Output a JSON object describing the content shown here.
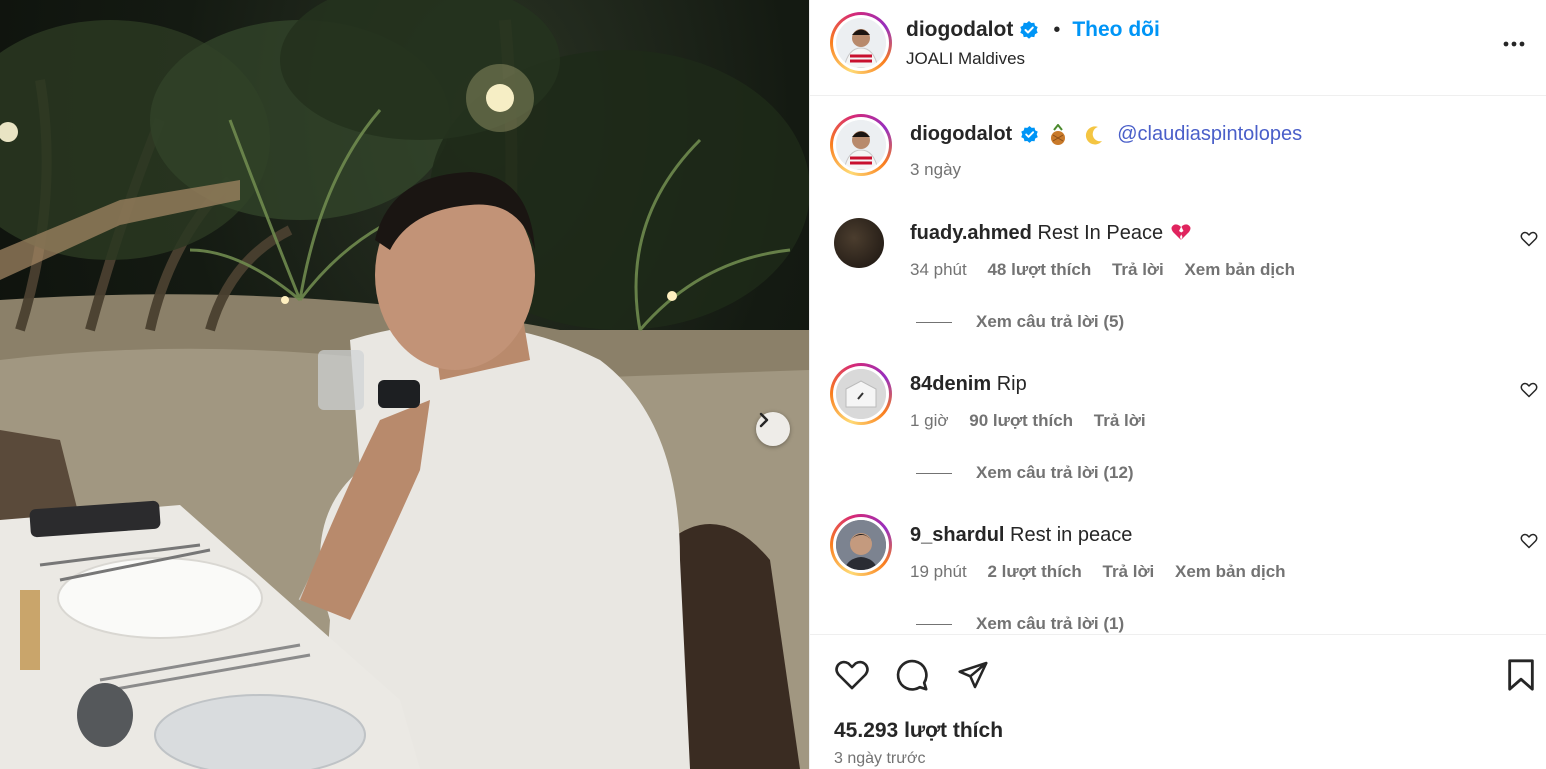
{
  "post": {
    "author": "diogodalot",
    "follow_label": "Theo dõi",
    "location": "JOALI Maldives",
    "caption_mention": "@claudiaspintolopes",
    "caption_time": "3 ngày",
    "likes": "45.293 lượt thích",
    "posted": "3 ngày trước"
  },
  "comments": [
    {
      "user": "fuady.ahmed",
      "text": "Rest In Peace",
      "time": "34 phút",
      "likes": "48 lượt thích",
      "reply": "Trả lời",
      "translate": "Xem bản dịch",
      "view_replies": "Xem câu trả lời (5)"
    },
    {
      "user": "84denim",
      "text": "Rip",
      "time": "1 giờ",
      "likes": "90 lượt thích",
      "reply": "Trả lời",
      "translate": "",
      "view_replies": "Xem câu trả lời (12)"
    },
    {
      "user": "9_shardul",
      "text": "Rest in peace",
      "time": "19 phút",
      "likes": "2 lượt thích",
      "reply": "Trả lời",
      "translate": "Xem bản dịch",
      "view_replies": "Xem câu trả lời (1)"
    }
  ],
  "icons": {
    "verified": "verified-badge-icon",
    "more": "more-options-icon",
    "next": "chevron-right-icon",
    "like": "heart-icon",
    "comment": "comment-icon",
    "share": "send-icon",
    "save": "bookmark-icon"
  },
  "colors": {
    "follow": "#0095f6",
    "verified": "#0095f6",
    "text": "#262626",
    "muted": "#737373"
  }
}
